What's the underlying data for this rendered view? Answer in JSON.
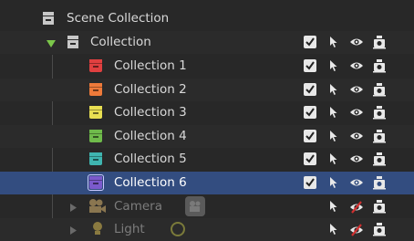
{
  "outliner": {
    "scene_collection": {
      "label": "Scene Collection"
    },
    "collection": {
      "label": "Collection"
    },
    "children": [
      {
        "label": "Collection 1",
        "color": "#e04040"
      },
      {
        "label": "Collection 2",
        "color": "#ee7a3a"
      },
      {
        "label": "Collection 3",
        "color": "#e8df52"
      },
      {
        "label": "Collection 4",
        "color": "#6fbb4b"
      },
      {
        "label": "Collection 5",
        "color": "#3fb5b0"
      },
      {
        "label": "Collection 6",
        "color": "#7b5acc"
      }
    ],
    "objects": [
      {
        "label": "Camera"
      },
      {
        "label": "Light"
      }
    ]
  },
  "colors": {
    "background": "#282828",
    "selected_row": "#334d80",
    "text": "#d9d9d9",
    "dim_text": "#7c7c7c"
  }
}
